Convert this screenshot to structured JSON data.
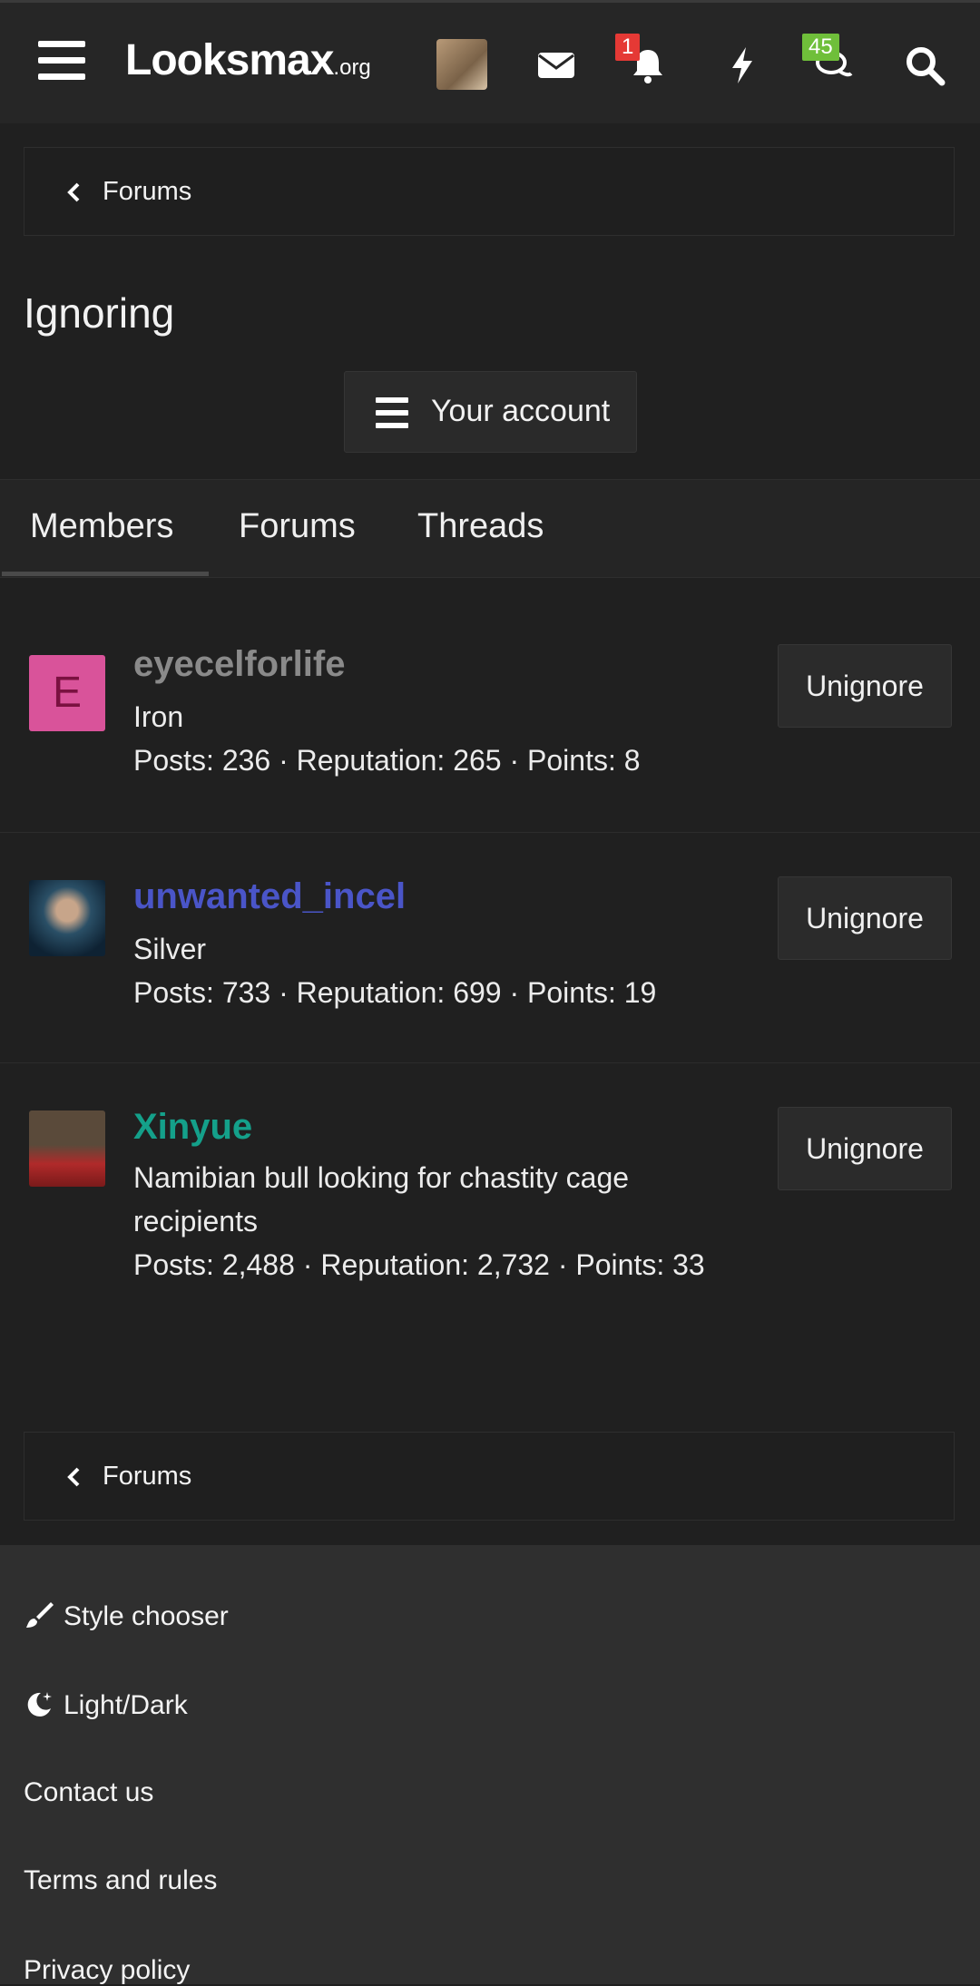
{
  "header": {
    "logo_main": "Looksmax",
    "logo_suffix": ".org",
    "notification_count": "1",
    "conversation_count": "45",
    "icons": [
      "menu-icon",
      "avatar",
      "envelope-icon",
      "bell-icon",
      "lightning-icon",
      "chat-icon",
      "search-icon"
    ]
  },
  "breadcrumb_top": {
    "label": "Forums"
  },
  "page": {
    "title": "Ignoring",
    "account_button": "Your account"
  },
  "tabs": [
    "Members",
    "Forums",
    "Threads"
  ],
  "members": [
    {
      "name": "eyecelforlife",
      "initial": "E",
      "title": "Iron",
      "stats": "Posts: 236 · Reputation: 265 · Points: 8",
      "action": "Unignore",
      "name_color": "#8a8a8a"
    },
    {
      "name": "unwanted_incel",
      "title": "Silver",
      "stats": "Posts: 733 · Reputation: 699 · Points: 19",
      "action": "Unignore",
      "name_color": "#4a55c8"
    },
    {
      "name": "Xinyue",
      "title": "Namibian bull looking for chastity cage recipients",
      "stats": "Posts: 2,488 · Reputation: 2,732 · Points: 33",
      "action": "Unignore",
      "name_color": "#14a08a"
    }
  ],
  "breadcrumb_bottom": {
    "label": "Forums"
  },
  "footer": {
    "links": [
      "Style chooser",
      "Light/Dark",
      "Contact us",
      "Terms and rules",
      "Privacy policy"
    ]
  },
  "colors": {
    "background": "#202020",
    "notification_badge": "#e53935",
    "conversation_badge": "#6fbf3a"
  }
}
